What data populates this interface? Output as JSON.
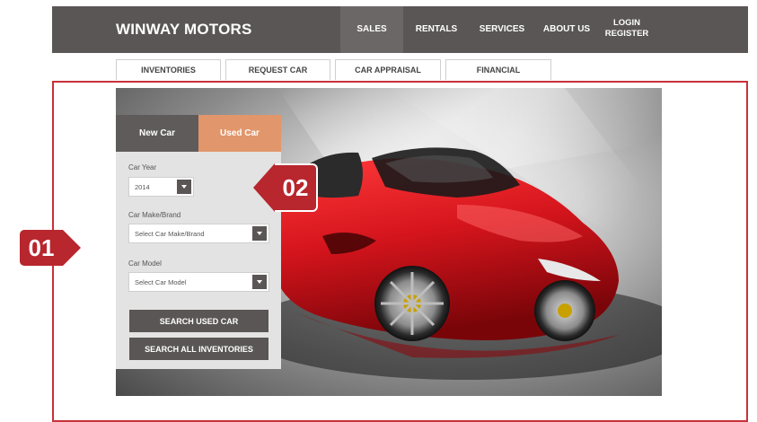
{
  "header": {
    "brand": "WINWAY MOTORS",
    "nav": [
      {
        "label": "SALES",
        "active": true
      },
      {
        "label": "RENTALS",
        "active": false
      },
      {
        "label": "SERVICES",
        "active": false
      },
      {
        "label": "ABOUT US",
        "active": false
      }
    ],
    "login": "LOGIN",
    "register": "REGISTER"
  },
  "subnav": [
    "INVENTORIES",
    "REQUEST CAR",
    "CAR APPRAISAL",
    "FINANCIAL"
  ],
  "search": {
    "tabs": {
      "new": "New Car",
      "used": "Used Car"
    },
    "active_tab": "used",
    "year": {
      "label": "Car Year",
      "value": "2014"
    },
    "make": {
      "label": "Car Make/Brand",
      "value": "Select Car Make/Brand"
    },
    "model": {
      "label": "Car Model",
      "value": "Select Car Model"
    },
    "buttons": {
      "search_used": "SEARCH USED CAR",
      "search_all": "SEARCH ALL INVENTORIES"
    }
  },
  "callouts": {
    "first": "01",
    "second": "02"
  },
  "colors": {
    "nav_bg": "#5a5655",
    "tab_used": "#e2966b",
    "callout_red": "#b8262e",
    "outline_red": "#c8323a",
    "car_red": "#d4141c"
  },
  "icons": [
    "dropdown-arrow-icon",
    "car-image"
  ]
}
